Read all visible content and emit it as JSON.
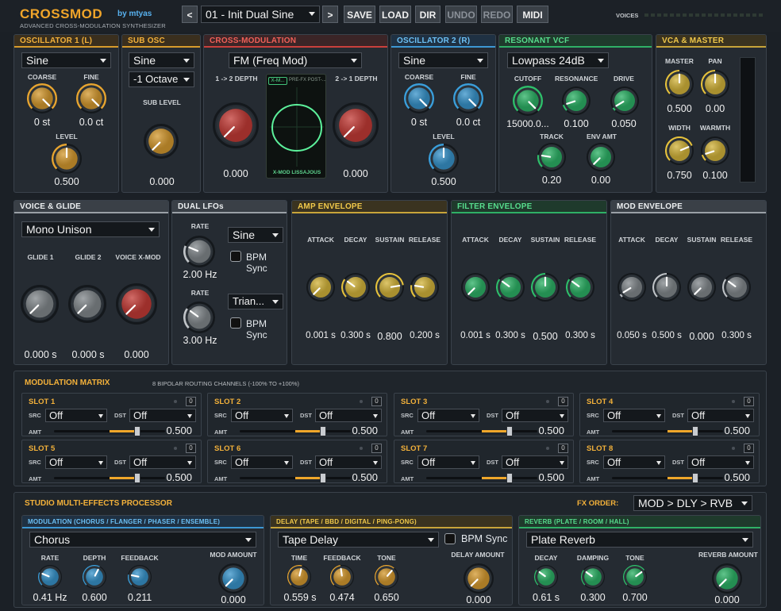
{
  "header": {
    "logo": "CROSSMOD",
    "by": "by mtyas",
    "subtitle": "ADVANCED CROSS-MODULATION SYNTHESIZER",
    "preset": "01 - Init Dual Sine",
    "prev": "<",
    "next": ">",
    "save": "SAVE",
    "load": "LOAD",
    "dir": "DIR",
    "undo": "UNDO",
    "redo": "REDO",
    "midi": "MIDI",
    "voices_label": "VOICES"
  },
  "osc1": {
    "title": "OSCILLATOR 1 (L)",
    "wave": "Sine",
    "coarse_l": "COARSE",
    "fine_l": "FINE",
    "level_l": "LEVEL",
    "coarse": "0 st",
    "fine": "0.0 ct",
    "level": "0.500"
  },
  "sub": {
    "title": "SUB OSC",
    "wave": "Sine",
    "octave": "-1 Octave",
    "level_l": "SUB LEVEL",
    "level": "0.000"
  },
  "xmod": {
    "title": "CROSS-MODULATION",
    "mode": "FM (Freq Mod)",
    "d12_l": "1 -> 2 DEPTH",
    "d21_l": "2 -> 1 DEPTH",
    "d12": "0.000",
    "d21": "0.000",
    "scope_tag": "X-M...",
    "scope_pre": "PRE-FX POST-...",
    "scope_label": "X-MOD LISSAJOUS"
  },
  "osc2": {
    "title": "OSCILLATOR 2 (R)",
    "wave": "Sine",
    "coarse_l": "COARSE",
    "fine_l": "FINE",
    "level_l": "LEVEL",
    "coarse": "0 st",
    "fine": "0.0 ct",
    "level": "0.500"
  },
  "vcf": {
    "title": "RESONANT VCF",
    "type": "Lowpass 24dB",
    "cutoff_l": "CUTOFF",
    "res_l": "RESONANCE",
    "drive_l": "DRIVE",
    "track_l": "TRACK",
    "env_l": "ENV AMT",
    "cutoff": "15000.0...",
    "res": "0.100",
    "drive": "0.050",
    "track": "0.20",
    "env": "0.00"
  },
  "vca": {
    "title": "VCA & MASTER",
    "master_l": "MASTER",
    "pan_l": "PAN",
    "width_l": "WIDTH",
    "warmth_l": "WARMTH",
    "master": "0.500",
    "pan": "0.00",
    "width": "0.750",
    "warmth": "0.100"
  },
  "voice": {
    "title": "VOICE & GLIDE",
    "mode": "Mono Unison",
    "g1_l": "GLIDE 1",
    "g2_l": "GLIDE 2",
    "vx_l": "VOICE X-MOD",
    "g1": "0.000 s",
    "g2": "0.000 s",
    "vx": "0.000"
  },
  "lfo": {
    "title": "DUAL LFOs",
    "rate_l": "RATE",
    "wave1": "Sine",
    "wave2": "Trian...",
    "sync": "BPM Sync",
    "rate1": "2.00 Hz",
    "rate2": "3.00 Hz"
  },
  "ampenv": {
    "title": "AMP ENVELOPE",
    "a_l": "ATTACK",
    "d_l": "DECAY",
    "s_l": "SUSTAIN",
    "r_l": "RELEASE",
    "a": "0.001 s",
    "d": "0.300 s",
    "s": "0.800",
    "r": "0.200 s"
  },
  "filtenv": {
    "title": "FILTER ENVELOPE",
    "a_l": "ATTACK",
    "d_l": "DECAY",
    "s_l": "SUSTAIN",
    "r_l": "RELEASE",
    "a": "0.001 s",
    "d": "0.300 s",
    "s": "0.500",
    "r": "0.300 s"
  },
  "modenv": {
    "title": "MOD ENVELOPE",
    "a_l": "ATTACK",
    "d_l": "DECAY",
    "s_l": "SUSTAIN",
    "r_l": "RELEASE",
    "a": "0.050 s",
    "d": "0.500 s",
    "s": "0.000",
    "r": "0.300 s"
  },
  "matrix": {
    "title": "MODULATION MATRIX",
    "desc": "8 BIPOLAR ROUTING CHANNELS (-100% TO +100%)",
    "src_l": "SRC",
    "dst_l": "DST",
    "amt_l": "AMT",
    "zero": "0",
    "slots": [
      {
        "name": "SLOT 1",
        "src": "Off",
        "dst": "Off",
        "amt": "0.500"
      },
      {
        "name": "SLOT 2",
        "src": "Off",
        "dst": "Off",
        "amt": "0.500"
      },
      {
        "name": "SLOT 3",
        "src": "Off",
        "dst": "Off",
        "amt": "0.500"
      },
      {
        "name": "SLOT 4",
        "src": "Off",
        "dst": "Off",
        "amt": "0.500"
      },
      {
        "name": "SLOT 5",
        "src": "Off",
        "dst": "Off",
        "amt": "0.500"
      },
      {
        "name": "SLOT 6",
        "src": "Off",
        "dst": "Off",
        "amt": "0.500"
      },
      {
        "name": "SLOT 7",
        "src": "Off",
        "dst": "Off",
        "amt": "0.500"
      },
      {
        "name": "SLOT 8",
        "src": "Off",
        "dst": "Off",
        "amt": "0.500"
      }
    ]
  },
  "fx": {
    "title": "STUDIO MULTI-EFFECTS PROCESSOR",
    "order_l": "FX ORDER:",
    "order": "MOD > DLY > RVB",
    "mod": {
      "title": "MODULATION (CHORUS / FLANGER / PHASER / ENSEMBLE)",
      "type": "Chorus",
      "rate_l": "RATE",
      "depth_l": "DEPTH",
      "fb_l": "FEEDBACK",
      "amt_l": "MOD AMOUNT",
      "rate": "0.41 Hz",
      "depth": "0.600",
      "fb": "0.211",
      "amt": "0.000"
    },
    "dly": {
      "title": "DELAY (TAPE / BBD / DIGITAL / PING-PONG)",
      "type": "Tape Delay",
      "sync": "BPM Sync",
      "time_l": "TIME",
      "fb_l": "FEEDBACK",
      "tone_l": "TONE",
      "amt_l": "DELAY AMOUNT",
      "time": "0.559 s",
      "fb": "0.474",
      "tone": "0.650",
      "amt": "0.000"
    },
    "rvb": {
      "title": "REVERB (PLATE / ROOM / HALL)",
      "type": "Plate Reverb",
      "decay_l": "DECAY",
      "damp_l": "DAMPING",
      "tone_l": "TONE",
      "amt_l": "REVERB AMOUNT",
      "decay": "0.61 s",
      "damp": "0.300",
      "tone": "0.700",
      "amt": "0.000"
    }
  },
  "colors": {
    "orange": "#e8a530",
    "red": "#d43c36",
    "blue": "#3a9fdc",
    "green": "#2ec06b",
    "gray": "#c0c4c8",
    "amber": "#e6c23c"
  }
}
